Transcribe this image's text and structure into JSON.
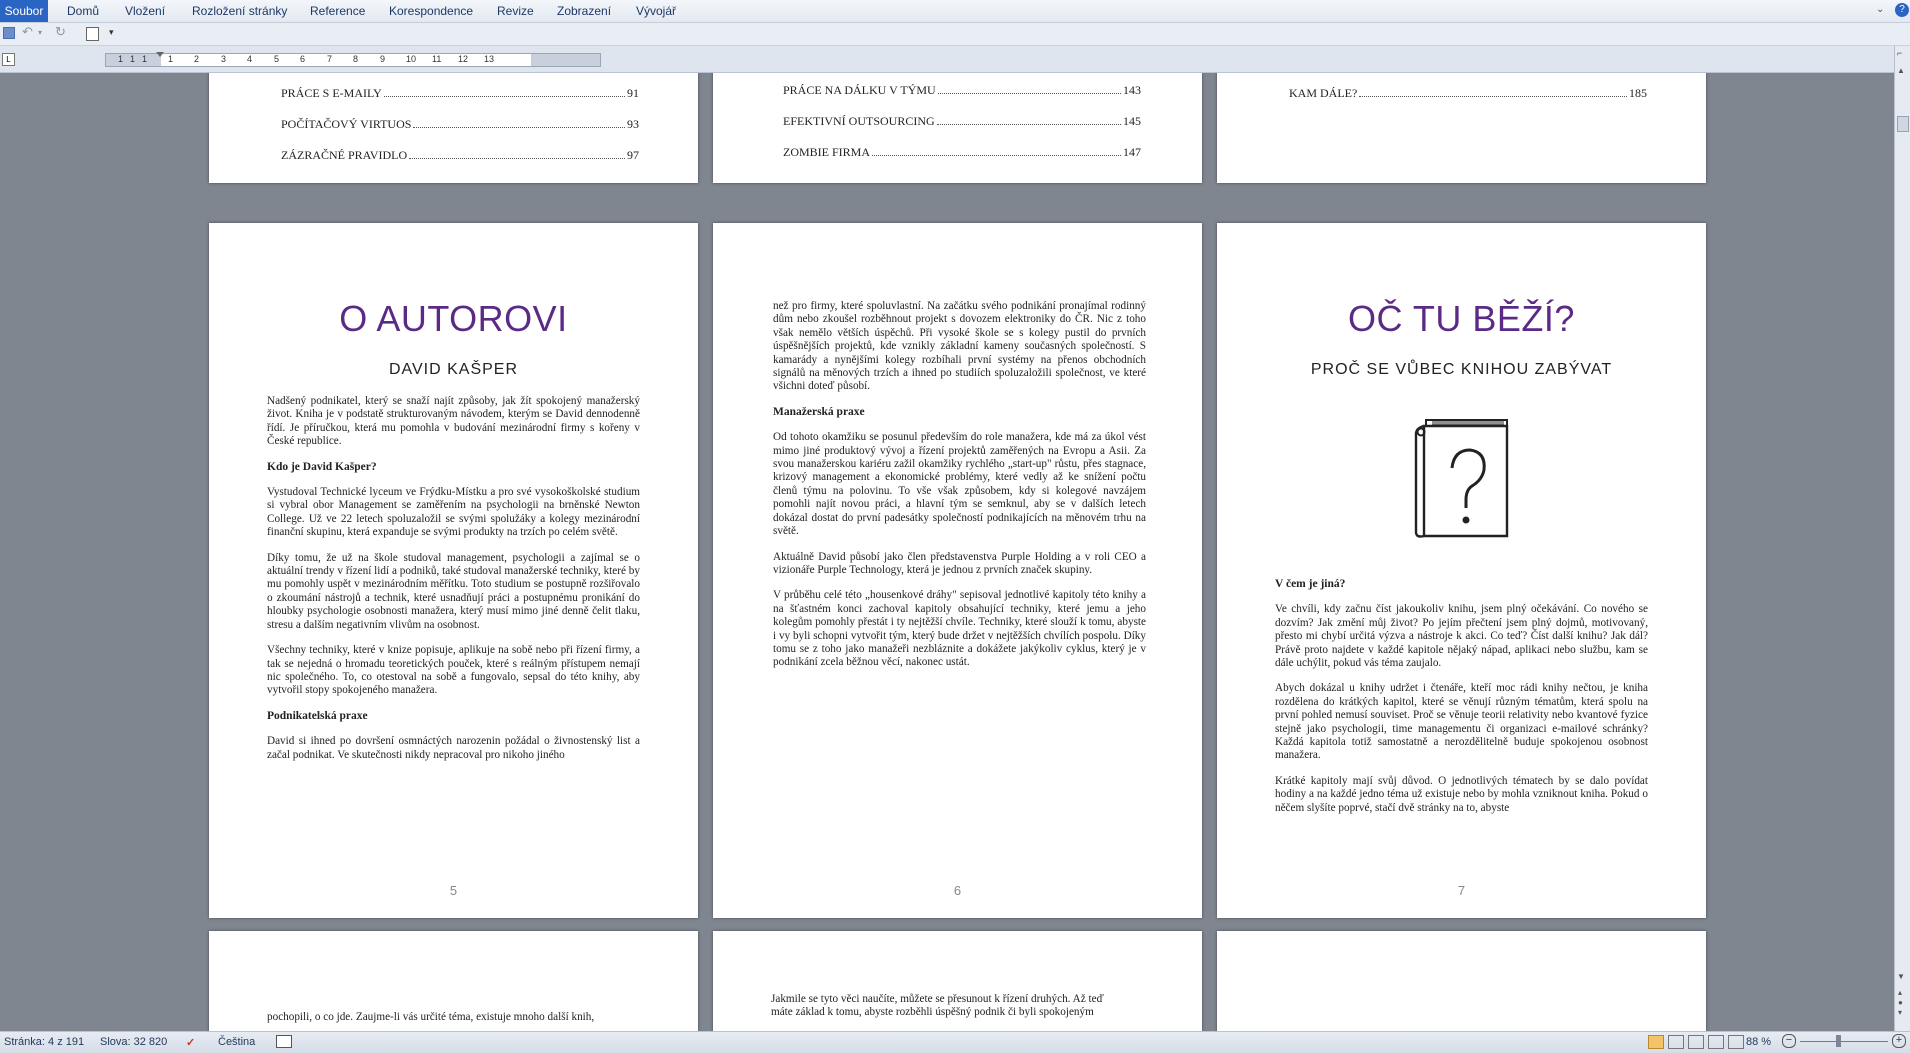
{
  "menu": {
    "tabs": [
      "Soubor",
      "Domů",
      "Vložení",
      "Rozložení stránky",
      "Reference",
      "Korespondence",
      "Revize",
      "Zobrazení",
      "Vývojář"
    ]
  },
  "ruler": {
    "ticks": [
      "1",
      "1",
      "1",
      "1",
      "2",
      "3",
      "4",
      "5",
      "6",
      "7",
      "8",
      "9",
      "10",
      "11",
      "12",
      "13"
    ]
  },
  "pages_top": {
    "col1": [
      {
        "label": "PRÁCE S E-MAILY",
        "num": "91"
      },
      {
        "label": "POČÍTAČOVÝ VIRTUOS",
        "num": "93"
      },
      {
        "label": "ZÁZRAČNÉ PRAVIDLO",
        "num": "97"
      }
    ],
    "col2": [
      {
        "label": "PRÁCE NA DÁLKU V TÝMU",
        "num": "143"
      },
      {
        "label": "EFEKTIVNÍ OUTSOURCING",
        "num": "145"
      },
      {
        "label": "ZOMBIE FIRMA",
        "num": "147"
      }
    ],
    "col3": [
      {
        "label": "KAM DÁLE?",
        "num": "185"
      }
    ]
  },
  "page5": {
    "title": "O AUTOROVI",
    "subtitle": "DAVID KAŠPER",
    "p1": "Nadšený podnikatel, který se snaží najít způsoby, jak žít spokojený manažerský život. Kniha je v podstatě strukturovaným návodem, kterým se David dennodenně řídí. Je příručkou, která mu pomohla v budování mezinárodní firmy s kořeny v České republice.",
    "h1": "Kdo je David Kašper?",
    "p2": "Vystudoval Technické lyceum ve Frýdku-Místku a pro své vysokoškolské studium si vybral obor Management se zaměřením na psychologii na brněnské Newton College. Už ve 22 letech spoluzaložil se svými spolužáky a kolegy mezinárodní finanční skupinu, která expanduje se svými produkty na trzích po celém světě.",
    "p3": "Díky tomu, že už na škole studoval management, psychologii a zajímal se o aktuální trendy v řízení lidí a podniků, také studoval manažerské techniky, které by mu pomohly uspět v mezinárodním měřítku. Toto studium se postupně rozšiřovalo o zkoumání nástrojů a technik, které usnadňují práci a postupnému pronikání do hloubky psychologie osobnosti manažera, který musí mimo jiné denně čelit tlaku, stresu a dalším negativním vlivům na osobnost.",
    "p4": "Všechny techniky, které v knize popisuje, aplikuje na sobě nebo při řízení firmy, a tak se nejedná o hromadu teoretických pouček, které s reálným přístupem nemají nic společného. To, co otestoval na sobě a fungovalo, sepsal do této knihy, aby vytvořil stopy spokojeného manažera.",
    "h2": "Podnikatelská praxe",
    "p5": "David si ihned po dovršení osmnáctých narozenin požádal o živnostenský list a začal podnikat. Ve skutečnosti nikdy nepracoval pro nikoho jiného",
    "num": "5"
  },
  "page6": {
    "p1": "než pro firmy, které spoluvlastní. Na začátku svého podnikání pronajímal rodinný dům nebo zkoušel rozběhnout projekt s dovozem elektroniky do ČR. Nic z toho však nemělo větších úspěchů. Při vysoké škole se s kolegy pustil do prvních úspěšnějších projektů, kde vznikly základní kameny současných společností. S kamarády a nynějšími kolegy rozbíhali první systémy na přenos obchodních signálů na měnových trzích a ihned po studiích spoluzaložili společnost, ve které všichni doteď působí.",
    "h1": "Manažerská praxe",
    "p2": "Od tohoto okamžiku se posunul především do role manažera, kde má za úkol vést mimo jiné produktový vývoj a řízení projektů zaměřených na Evropu a Asii. Za svou manažerskou kariéru zažil okamžiky rychlého „start-up\" růstu, přes stagnace, krizový management a ekonomické problémy, které vedly až ke snížení počtu členů týmu na polovinu. To vše však způsobem, kdy si kolegové navzájem pomohli najít novou práci, a hlavní tým se semknul, aby se v dalších letech dokázal dostat do první padesátky společností podnikajících na měnovém trhu na světě.",
    "p3": "Aktuálně David působí jako člen představenstva Purple Holding a v roli CEO a vizionáře Purple Technology, která je jednou z prvních značek skupiny.",
    "p4": "V průběhu celé této „housenkové dráhy\" sepisoval jednotlivé kapitoly této knihy a na šťastném konci zachoval kapitoly obsahující techniky, které jemu a jeho kolegům pomohly přestát i ty nejtěžší chvíle. Techniky, které slouží k tomu, abyste i vy byli schopni vytvořit tým, který bude držet v nejtěžších chvílích pospolu. Díky tomu se z toho jako manažeři nezbláznite a dokážete jakýkoliv cyklus, který je v podnikání zcela běžnou věcí, nakonec ustát.",
    "num": "6"
  },
  "page7": {
    "title": "OČ TU BĚŽÍ?",
    "subtitle": "PROČ SE VŮBEC KNIHOU ZABÝVAT",
    "icon": "book-question-icon",
    "h1": "V čem je jiná?",
    "p1": "Ve chvíli, kdy začnu číst jakoukoliv knihu, jsem plný očekávání. Co nového se dozvím? Jak změní můj život? Po jejím přečtení jsem plný dojmů, motivovaný, přesto mi chybí určitá výzva a nástroje k akci. Co teď? Číst další knihu? Jak dál? Právě proto najdete v každé kapitole nějaký nápad, aplikaci nebo službu, kam se dále uchýlit, pokud vás téma zaujalo.",
    "p2": "Abych dokázal u knihy udržet i čtenáře, kteří moc rádi knihy nečtou, je kniha rozdělena do krátkých kapitol, které se věnují různým tématům, která spolu na první pohled nemusí souviset. Proč se věnuje teorii relativity nebo kvantové fyzice stejně jako psychologii, time managementu či organizaci e-mailové schránky? Každá kapitola totiž samostatně a nerozdělitelně buduje spokojenou osobnost manažera.",
    "p3": "Krátké kapitoly mají svůj důvod. O jednotlivých tématech by se dalo povídat hodiny a na každé jedno téma už existuje nebo by mohla vzniknout kniha. Pokud o něčem slyšíte poprvé, stačí dvě stránky na to, abyste",
    "num": "7"
  },
  "pages_bottom": {
    "col1": "pochopili, o co jde. Zaujme-li vás určité téma, existuje mnoho další knih,",
    "col2a": "Jakmile se tyto věci naučíte, můžete se přesunout k řízení druhých. Až teď",
    "col2b": "máte základ k tomu, abyste rozběhli úspěšný podnik či byli spokojeným"
  },
  "status": {
    "page": "Stránka: 4 z 191",
    "words": "Slova: 32 820",
    "lang": "Čeština",
    "zoom": "88 %"
  }
}
